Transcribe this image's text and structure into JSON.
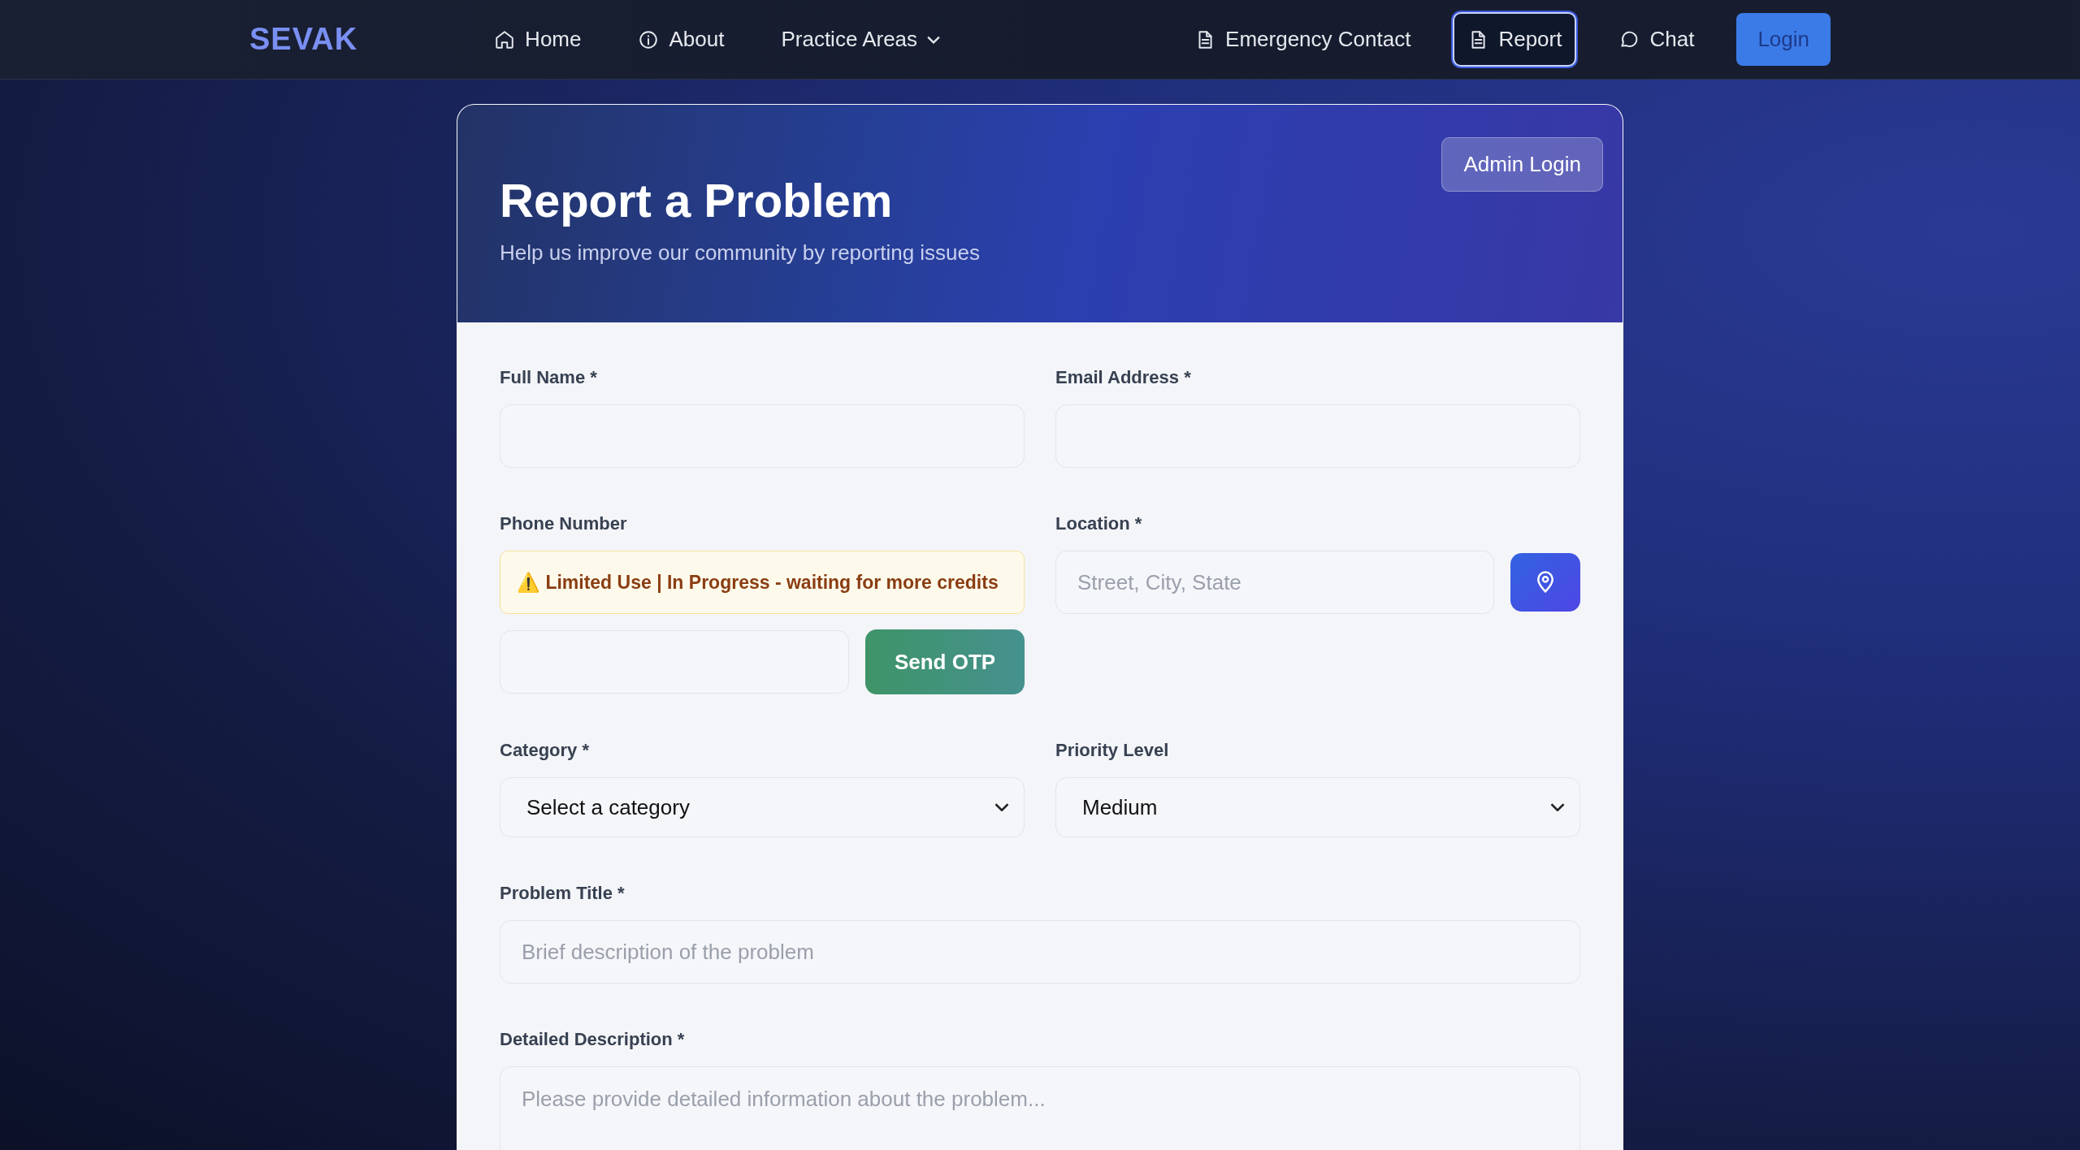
{
  "nav": {
    "logo": "SEVAK",
    "items": [
      {
        "label": "Home",
        "kind": "home",
        "selected": false
      },
      {
        "label": "About",
        "kind": "info",
        "selected": false
      },
      {
        "label": "Practice Areas",
        "kind": "dropdown",
        "selected": false
      }
    ],
    "right_items": [
      {
        "label": "Emergency Contact",
        "kind": "document",
        "selected": false
      },
      {
        "label": "Report",
        "kind": "document",
        "selected": true
      },
      {
        "label": "Chat",
        "kind": "chat",
        "selected": false
      }
    ],
    "login": "Login"
  },
  "header": {
    "title": "Report a Problem",
    "subtitle": "Help us improve our community by reporting issues",
    "admin_button": "Admin Login"
  },
  "form": {
    "rows": [
      [
        {
          "kind": "text",
          "label": "Full Name *"
        },
        {
          "kind": "text",
          "label": "Email Address *"
        }
      ],
      [
        {
          "kind": "phone",
          "label": "Phone Number",
          "notice": "⚠️ Limited Use | In Progress - waiting for more credits",
          "button": "Send OTP"
        },
        {
          "kind": "location",
          "label": "Location *",
          "placeholder": "Street, City, State"
        }
      ],
      [
        {
          "kind": "select",
          "label": "Category *",
          "value": "Select a category"
        },
        {
          "kind": "select",
          "label": "Priority Level",
          "value": "Medium"
        }
      ],
      [
        {
          "kind": "text",
          "label": "Problem Title *",
          "placeholder": "Brief description of the problem"
        }
      ],
      [
        {
          "kind": "textarea",
          "label": "Detailed Description *",
          "placeholder": "Please provide detailed information about the problem..."
        }
      ]
    ]
  }
}
